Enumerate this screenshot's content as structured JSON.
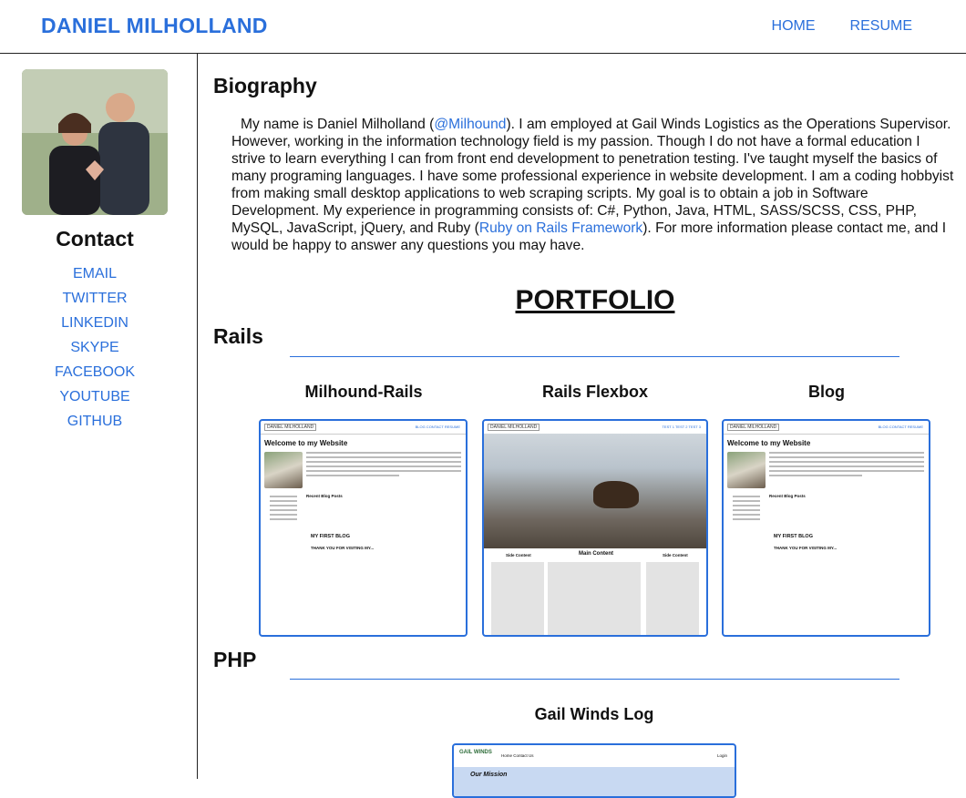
{
  "header": {
    "brand": "DANIEL MILHOLLAND",
    "nav": [
      "HOME",
      "RESUME"
    ]
  },
  "sidebar": {
    "contact_title": "Contact",
    "links": [
      "EMAIL",
      "TWITTER",
      "LINKEDIN",
      "SKYPE",
      "FACEBOOK",
      "YOUTUBE",
      "GITHUB"
    ]
  },
  "main": {
    "bio_title": "Biography",
    "bio": {
      "p1": "My name is Daniel Milholland (",
      "handle": "@Milhound",
      "p2": "). I am employed at Gail Winds Logistics as the Operations Supervisor. However, working in the information technology field is my passion. Though I do not have a formal education I strive to learn everything I can from front end development to penetration testing. I've taught myself the basics of many programing languages. I have some professional experience in website development. I am a coding hobbyist from making small desktop applications to web scraping scripts. My goal is to obtain a job in Software Development. My experience in programming consists of: C#, Python, Java, HTML, SASS/SCSS, CSS, PHP, MySQL, JavaScript, jQuery, and Ruby (",
      "rails_link": "Ruby on Rails Framework",
      "p3": "). For more information please contact me, and I would be happy to answer any questions you may have."
    },
    "portfolio_title": "PORTFOLIO",
    "sections": [
      {
        "title": "Rails",
        "projects": [
          "Milhound-Rails",
          "Rails Flexbox",
          "Blog"
        ]
      },
      {
        "title": "PHP",
        "projects": [
          "Gail Winds Log"
        ]
      }
    ]
  },
  "thumbs": {
    "site_brand": "DANIEL MILHOLLAND",
    "site_links": "BLOG   CONTACT   RESUME",
    "welcome": "Welcome to my Website",
    "recent": "Recent Blog Posts",
    "first_blog": "MY FIRST BLOG",
    "thanks": "THANK YOU FOR VISITING MY...",
    "flex_links": "TEST 1   TEST 2   TEST 3",
    "side": "Side Content",
    "main_content": "Main Content",
    "gw_nav": "Home   Contact Us",
    "gw_login": "Login",
    "gw_mission": "Our Mission",
    "gw_logo": "GAIL WINDS"
  },
  "colors": {
    "link": "#2a6fdb",
    "text": "#111111",
    "border": "#222222"
  }
}
